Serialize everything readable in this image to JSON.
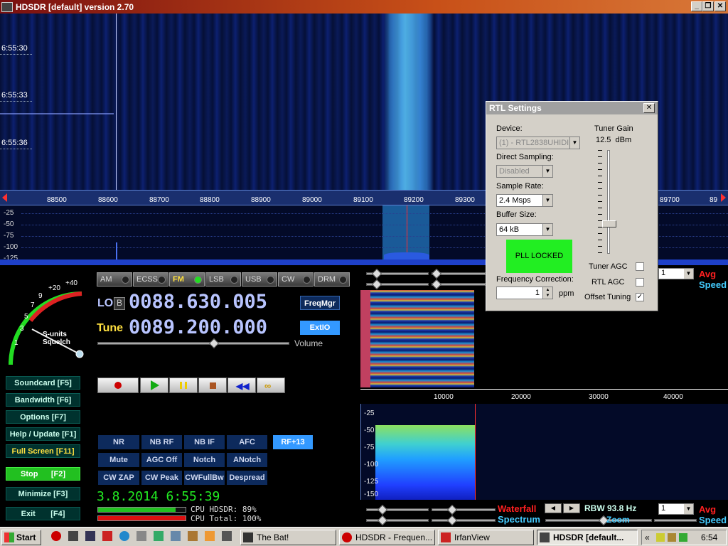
{
  "window": {
    "title": "HDSDR [default]  version 2.70"
  },
  "waterfall": {
    "times": [
      "6:55:30",
      "6:55:33",
      "6:55:36"
    ]
  },
  "ruler": {
    "labels": [
      "88500",
      "88600",
      "88700",
      "88800",
      "88900",
      "89000",
      "89100",
      "89200",
      "89300",
      "89700",
      "89"
    ]
  },
  "spectrum": {
    "db_labels": [
      "-25",
      "-50",
      "-75",
      "-100",
      "-125"
    ]
  },
  "modes": [
    "AM",
    "ECSS",
    "FM",
    "LSB",
    "USB",
    "CW",
    "DRM"
  ],
  "active_mode": "FM",
  "lo": {
    "label": "LO",
    "badge": "B",
    "value": "0088.630.005",
    "button": "FreqMgr"
  },
  "tune": {
    "label": "Tune",
    "value": "0089.200.000",
    "button": "ExtIO"
  },
  "volume_label": "Volume",
  "smeter": {
    "labels": [
      "1",
      "3",
      "5",
      "7",
      "9",
      "+20",
      "+40"
    ],
    "caption1": "S-units",
    "caption2": "Squelch"
  },
  "side_buttons": [
    {
      "label": "Soundcard  [F5]"
    },
    {
      "label": "Bandwidth  [F6]"
    },
    {
      "label": "Options  [F7]"
    },
    {
      "label": "Help / Update  [F1]"
    },
    {
      "label": "Full Screen  [F11]"
    },
    {
      "label": "Stop",
      "key": "[F2]"
    },
    {
      "label": "Minimize  [F3]"
    },
    {
      "label": "Exit",
      "key": "[F4]"
    }
  ],
  "dsp_buttons": [
    [
      "NR",
      "NB RF",
      "NB IF",
      "AFC"
    ],
    [
      "Mute",
      "AGC Off",
      "Notch",
      "ANotch"
    ],
    [
      "CW ZAP",
      "CW Peak",
      "CWFullBw",
      "Despread"
    ]
  ],
  "rf_button": "RF+13",
  "datetime": "3.8.2014 6:55:39",
  "cpu": {
    "hdsdr_label": "CPU HDSDR:",
    "hdsdr_value": "89%",
    "total_label": "CPU Total:",
    "total_value": "100%",
    "hdsdr_pct": 89,
    "total_pct": 100
  },
  "audio": {
    "axis_labels": [
      "10000",
      "20000",
      "30000",
      "40000"
    ],
    "db_labels": [
      "-25",
      "-50",
      "-75",
      "-100",
      "-125",
      "-150"
    ],
    "top": {
      "select": "1",
      "avg": "Avg",
      "speed": "Speed"
    },
    "bottom": {
      "waterfall": "Waterfall",
      "spectrum": "Spectrum",
      "zoom": "Zoom",
      "rbw": "RBW 93.8 Hz",
      "select": "1",
      "avg": "Avg",
      "speed": "Speed"
    }
  },
  "rtl": {
    "title": "RTL Settings",
    "device_label": "Device:",
    "device_value": "(1) - RTL2838UHIDIR",
    "direct_label": "Direct Sampling:",
    "direct_value": "Disabled",
    "rate_label": "Sample Rate:",
    "rate_value": "2.4 Msps",
    "buffer_label": "Buffer Size:",
    "buffer_value": "64 kB",
    "pll": "PLL LOCKED",
    "freqcorr_label": "Frequency Correction:",
    "freqcorr_value": "1",
    "ppm": "ppm",
    "gain_label": "Tuner Gain",
    "gain_value": "12.5",
    "gain_unit": "dBm",
    "tuner_agc": "Tuner AGC",
    "rtl_agc": "RTL AGC",
    "offset_tuning": "Offset Tuning",
    "offset_checked": "✓",
    "gain_level": 0.27
  },
  "taskbar": {
    "start": "Start",
    "tasks": [
      "The Bat!",
      "HDSDR - Frequen...",
      "IrfanView",
      "HDSDR [default..."
    ],
    "clock": "6:54",
    "tray_arrow": "«"
  },
  "colors": {
    "accent_blue": "#3399ff",
    "stop_green": "#22c020",
    "pll_green": "#22ee22",
    "avg_red": "#ff2020",
    "speed_cyan": "#44ccff"
  }
}
